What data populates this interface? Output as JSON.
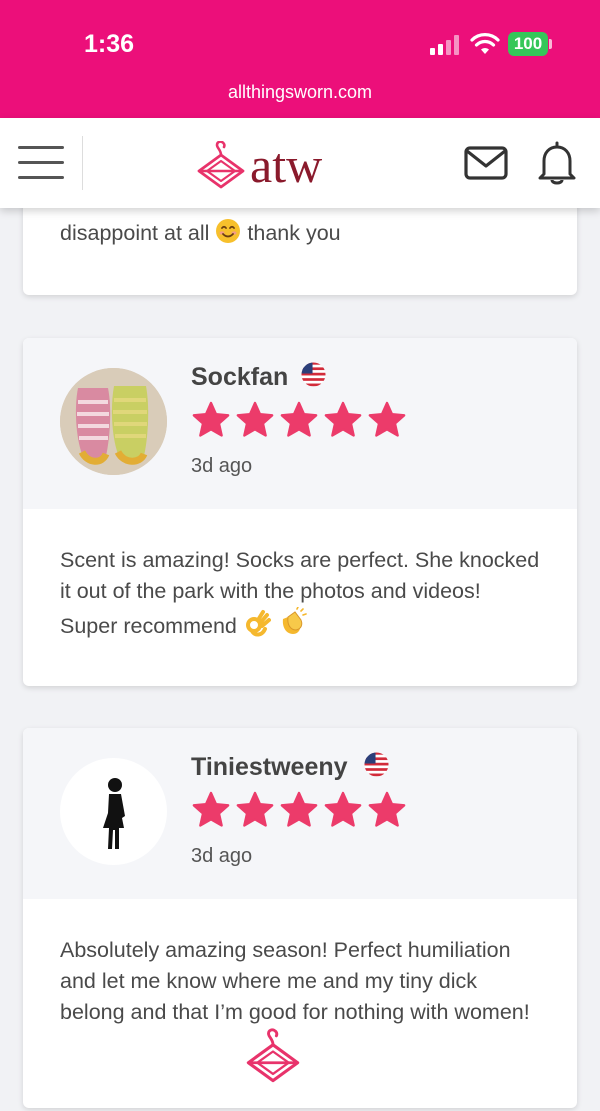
{
  "status": {
    "time": "1:36",
    "battery": "100"
  },
  "browser": {
    "url": "allthingsworn.com"
  },
  "header": {
    "logo_text": "atw"
  },
  "reviews": [
    {
      "body": "disappoint at all",
      "body_end": "thank you"
    },
    {
      "name": "Sockfan",
      "rating": 5,
      "time": "3d ago",
      "body": "Scent is amazing! Socks are perfect. She knocked it out of the park with the photos and videos! Super recommend"
    },
    {
      "name": "Tiniestweeny",
      "rating": 5,
      "time": "3d ago",
      "body": "Absolutely amazing season! Perfect humiliation and let me know where me and my tiny dick belong and that I’m good for nothing with women!"
    }
  ],
  "colors": {
    "brand_pink": "#ec0f7a",
    "star": "#ec3b6a",
    "logo_red": "#8a1a2c"
  },
  "icons": [
    "menu-icon",
    "hanger-logo-icon",
    "mail-icon",
    "bell-icon",
    "us-flag-icon",
    "star-icon",
    "woman-silhouette-icon"
  ]
}
